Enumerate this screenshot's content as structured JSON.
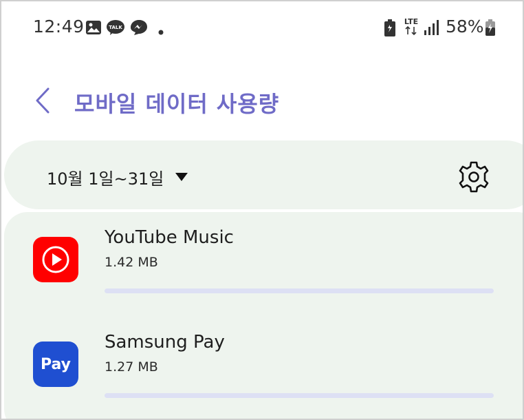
{
  "status_bar": {
    "time": "12:49",
    "network": "LTE",
    "battery_percent": "58%",
    "icons": [
      "gallery-icon",
      "kakaotalk-icon",
      "messenger-icon",
      "dot-icon",
      "battery-saver-icon",
      "lte-icon",
      "signal-icon",
      "battery-icon"
    ]
  },
  "header": {
    "title": "모바일 데이터 사용량"
  },
  "range": {
    "label": "10월 1일~31일"
  },
  "apps": [
    {
      "name": "YouTube Music",
      "size": "1.42 MB",
      "usage_fraction": 0.0,
      "icon": "youtube-music-icon",
      "color": "#ff0000"
    },
    {
      "name": "Samsung Pay",
      "size": "1.27 MB",
      "usage_fraction": 0.0,
      "icon": "samsung-pay-icon",
      "color": "#1f4fd1",
      "icon_text": "Pay"
    }
  ],
  "colors": {
    "accent": "#6f6bc7",
    "card_bg": "#eef4ee",
    "bar_track": "#dde0f4"
  }
}
